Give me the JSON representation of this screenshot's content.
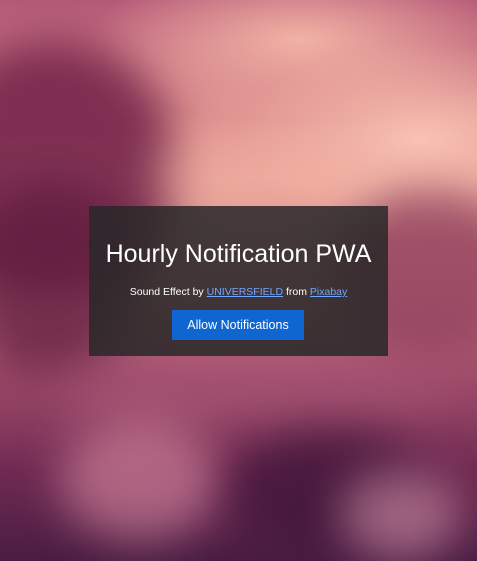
{
  "app": {
    "title": "Hourly Notification PWA"
  },
  "credit": {
    "prefix": "Sound Effect by",
    "author_link": "UNIVERSFIELD",
    "middle": "from",
    "source_link": "Pixabay"
  },
  "actions": {
    "allow_notifications_label": "Allow Notifications"
  },
  "colors": {
    "button_bg": "#0f66d0",
    "link": "#6fa8ff",
    "dialog_bg": "rgba(40,40,40,0.85)"
  }
}
